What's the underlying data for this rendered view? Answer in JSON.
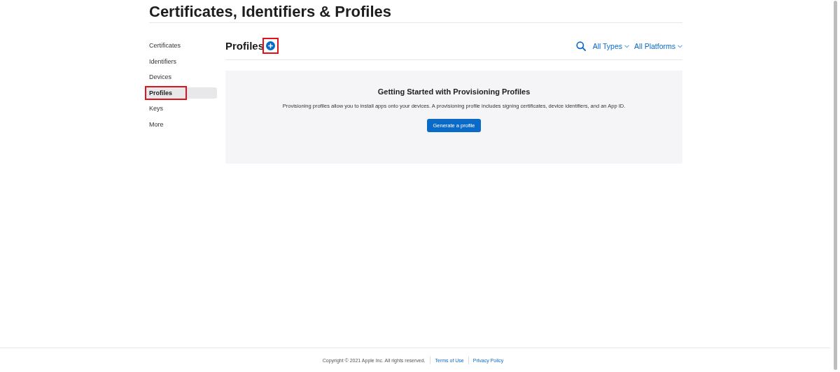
{
  "page_title": "Certificates, Identifiers & Profiles",
  "sidebar": {
    "items": [
      {
        "label": "Certificates",
        "selected": false,
        "highlighted": false
      },
      {
        "label": "Identifiers",
        "selected": false,
        "highlighted": false
      },
      {
        "label": "Devices",
        "selected": false,
        "highlighted": false
      },
      {
        "label": "Profiles",
        "selected": true,
        "highlighted": true
      },
      {
        "label": "Keys",
        "selected": false,
        "highlighted": false
      },
      {
        "label": "More",
        "selected": false,
        "highlighted": false
      }
    ]
  },
  "header": {
    "title": "Profiles",
    "add_button_highlighted": true,
    "filters": [
      "All Types",
      "All Platforms"
    ]
  },
  "empty_state": {
    "title": "Getting Started with Provisioning Profiles",
    "description": "Provisioning profiles allow you to install apps onto your devices. A provisioning profile includes signing certificates, device identifiers, and an App ID.",
    "button": "Generate a profile"
  },
  "footer": {
    "copyright": "Copyright © 2021 Apple Inc. All rights reserved.",
    "links": [
      "Terms of Use",
      "Privacy Policy"
    ]
  }
}
